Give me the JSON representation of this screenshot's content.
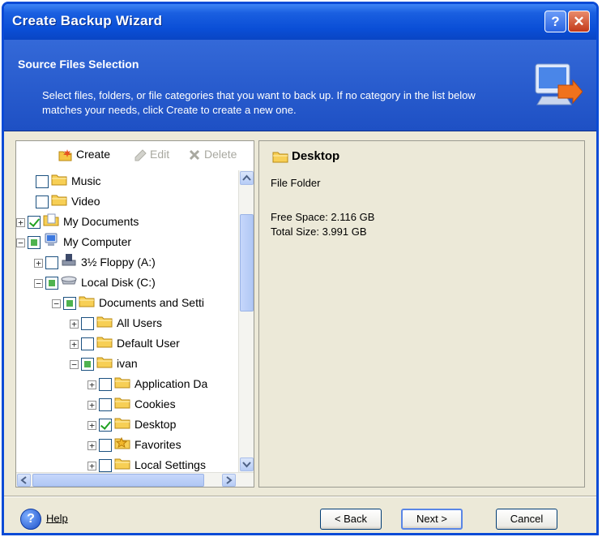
{
  "window": {
    "title": "Create Backup Wizard",
    "help_glyph": "?",
    "close_glyph": "✕"
  },
  "header": {
    "title": "Source Files Selection",
    "description": "Select files, folders, or file categories that you want to back up. If no category in the list below matches your needs, click Create to create a new one.",
    "icon": "computer-arrow-icon"
  },
  "toolbar": {
    "create_label": "Create",
    "edit_label": "Edit",
    "delete_label": "Delete"
  },
  "tree": {
    "rows": [
      {
        "label": "Music",
        "expander": "none",
        "check": "empty",
        "icon": "folder-icon"
      },
      {
        "label": "Video",
        "expander": "none",
        "check": "empty",
        "icon": "folder-icon"
      },
      {
        "label": "My Documents",
        "expander": "plus",
        "check": "checked",
        "icon": "documents-icon"
      },
      {
        "label": "My Computer",
        "expander": "minus",
        "check": "partial",
        "icon": "computer-icon"
      },
      {
        "label": "3½ Floppy (A:)",
        "expander": "plus",
        "check": "empty",
        "icon": "floppy-icon"
      },
      {
        "label": "Local Disk (C:)",
        "expander": "minus",
        "check": "partial",
        "icon": "disk-icon"
      },
      {
        "label": "Documents and Setti",
        "expander": "minus",
        "check": "partial",
        "icon": "folder-icon"
      },
      {
        "label": "All Users",
        "expander": "plus",
        "check": "empty",
        "icon": "folder-icon"
      },
      {
        "label": "Default User",
        "expander": "plus",
        "check": "empty",
        "icon": "folder-icon"
      },
      {
        "label": "ivan",
        "expander": "minus",
        "check": "partial",
        "icon": "folder-icon"
      },
      {
        "label": "Application Da",
        "expander": "plus",
        "check": "empty",
        "icon": "folder-icon"
      },
      {
        "label": "Cookies",
        "expander": "plus",
        "check": "empty",
        "icon": "folder-icon"
      },
      {
        "label": "Desktop",
        "expander": "plus",
        "check": "checked",
        "icon": "folder-icon"
      },
      {
        "label": "Favorites",
        "expander": "plus",
        "check": "empty",
        "icon": "star-icon"
      },
      {
        "label": "Local Settings",
        "expander": "plus",
        "check": "empty",
        "icon": "folder-icon"
      }
    ]
  },
  "details": {
    "name": "Desktop",
    "type": "File Folder",
    "free_space": "Free Space: 2.116 GB",
    "total_size": "Total Size: 3.991 GB"
  },
  "footer": {
    "help_label": "Help",
    "back_label": "< Back",
    "next_label": "Next >",
    "cancel_label": "Cancel"
  }
}
